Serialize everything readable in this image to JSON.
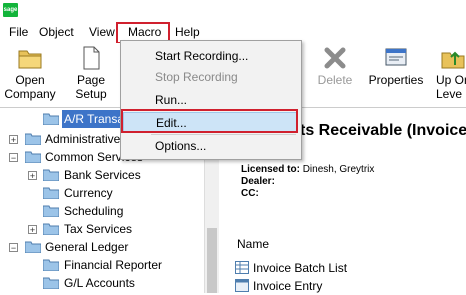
{
  "app": {
    "logo_text": "sage"
  },
  "menubar": {
    "items": [
      "File",
      "Object",
      "View",
      "Macro",
      "Help"
    ]
  },
  "toolbar": {
    "open_company": [
      "Open",
      "Company"
    ],
    "page_setup": [
      "Page",
      "Setup"
    ],
    "delete": "Delete",
    "properties": "Properties",
    "up_one_level": [
      "Up On",
      "Leve"
    ]
  },
  "macro_menu": {
    "items": [
      {
        "label": "Start Recording...",
        "enabled": true
      },
      {
        "label": "Stop Recording",
        "enabled": false
      },
      {
        "label": "Run...",
        "enabled": true
      },
      {
        "label": "Edit...",
        "enabled": true,
        "highlighted": true
      },
      {
        "label": "Options...",
        "enabled": true
      }
    ]
  },
  "tree": {
    "items": [
      {
        "label": "A/R Transa",
        "selected": true
      },
      {
        "label": "Administrative"
      },
      {
        "label": "Common Services"
      },
      {
        "label": "Bank Services"
      },
      {
        "label": "Currency"
      },
      {
        "label": "Scheduling"
      },
      {
        "label": "Tax Services"
      },
      {
        "label": "General Ledger"
      },
      {
        "label": "Financial Reporter"
      },
      {
        "label": "G/L Accounts"
      }
    ]
  },
  "main": {
    "title": "ts Receivable (Invoice",
    "licensed_label": "Licensed to:",
    "licensed_value": "Dinesh, Greytrix",
    "dealer_label": "Dealer:",
    "cc_label": "CC:",
    "list_header": "Name",
    "list_items": [
      "Invoice Batch List",
      "Invoice Entry"
    ]
  },
  "colors": {
    "highlight_red": "#d0202e",
    "selection_blue": "#cde4f7",
    "brand_green": "#12b43a"
  }
}
